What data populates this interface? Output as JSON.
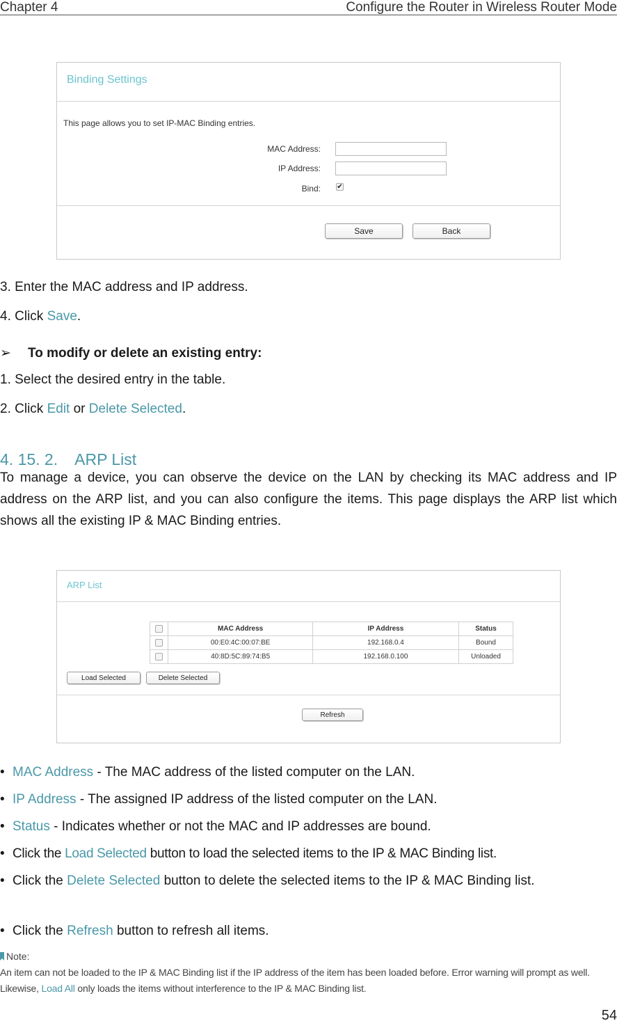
{
  "header": {
    "chapter": "Chapter 4",
    "section_title": "Configure the Router in Wireless Router Mode"
  },
  "binding_settings_screenshot": {
    "title": "Binding Settings",
    "description": "This page allows you to set IP-MAC Binding entries.",
    "fields": [
      {
        "label": "MAC Address:",
        "value": "",
        "type": "text"
      },
      {
        "label": "IP Address:",
        "value": "",
        "type": "text"
      },
      {
        "label": "Bind:",
        "checked": true,
        "type": "checkbox"
      }
    ],
    "buttons": {
      "save": "Save",
      "back": "Back"
    }
  },
  "steps_add": [
    {
      "prefix": "3. Enter the MAC address and IP address.",
      "link": "",
      "suffix": ""
    },
    {
      "prefix": "4. Click ",
      "link": "Save",
      "suffix": "."
    }
  ],
  "modify_heading": {
    "marker": "➢",
    "text": "To modify or delete an existing entry:"
  },
  "steps_modify": {
    "step1": "1. Select the desired entry in the table.",
    "step2_prefix": "2. Click ",
    "step2_link1": "Edit",
    "step2_mid": " or ",
    "step2_link2": "Delete Selected",
    "step2_suffix": "."
  },
  "section": {
    "number": "4. 15. 2.",
    "title": "ARP List",
    "intro": "To manage a device, you can observe the device on the LAN by checking its MAC address and IP address on the ARP list, and you can also configure the items. This page displays the ARP list which shows all the existing IP & MAC Binding entries."
  },
  "arp_screenshot": {
    "title": "ARP List",
    "columns": [
      "",
      "MAC Address",
      "IP Address",
      "Status"
    ],
    "rows": [
      {
        "checked": false,
        "mac": "00:E0:4C:00:07:BE",
        "ip": "192.168.0.4",
        "status": "Bound"
      },
      {
        "checked": false,
        "mac": "40:8D:5C:89:74:B5",
        "ip": "192.168.0.100",
        "status": "Unloaded"
      }
    ],
    "buttons": {
      "load_selected": "Load Selected",
      "delete_selected": "Delete Selected",
      "refresh": "Refresh"
    }
  },
  "bullets": [
    {
      "prefix": "",
      "link": "MAC Address",
      "suffix": " - The MAC address of the listed computer on the LAN."
    },
    {
      "prefix": "",
      "link": "IP Address",
      "suffix": " - The assigned IP address of the listed computer on the LAN."
    },
    {
      "prefix": "",
      "link": "Status",
      "suffix": " - Indicates whether or not the MAC and IP addresses are bound."
    },
    {
      "prefix": "Click the ",
      "link": "Load Selected",
      "suffix": " button to load the selected items to the IP & MAC Binding list."
    },
    {
      "prefix": "Click the ",
      "link": "Delete Selected",
      "suffix": " button to delete the selected items to the IP & MAC Binding list."
    },
    {
      "prefix": "Click the ",
      "link": "Refresh",
      "suffix": " button to refresh all items."
    }
  ],
  "note": {
    "label": "Note:",
    "text_prefix": "An item can not be loaded to the IP & MAC Binding list if the IP address of the item has been loaded before. Error warning will prompt as well. Likewise, ",
    "link": "Load All",
    "text_suffix": " only loads the items without interference to the IP & MAC Binding list."
  },
  "page_number": "54",
  "colors": {
    "link": "#4a98a8",
    "ui_title": "#6cc4cf"
  }
}
